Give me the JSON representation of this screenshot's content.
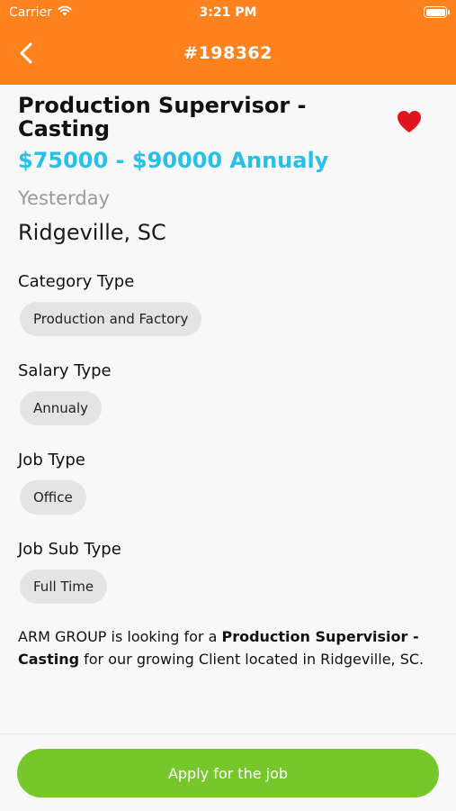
{
  "status_bar": {
    "carrier": "Carrier",
    "time": "3:21 PM"
  },
  "nav": {
    "title": "#198362"
  },
  "job": {
    "title": "Production Supervisor - Casting",
    "salary": "$75000 - $90000 Annualy",
    "posted": "Yesterday",
    "location": "Ridgeville, SC",
    "favorited": true
  },
  "sections": {
    "category": {
      "label": "Category Type",
      "value": "Production and Factory"
    },
    "salary_type": {
      "label": "Salary Type",
      "value": "Annualy"
    },
    "job_type": {
      "label": "Job Type",
      "value": "Office"
    },
    "job_sub_type": {
      "label": "Job Sub Type",
      "value": "Full Time"
    }
  },
  "description": {
    "prefix": "ARM GROUP is looking for a ",
    "highlight": "Production Supervisior - Casting",
    "suffix": " for our growing Client located in Ridgeville, SC."
  },
  "footer": {
    "apply_label": "Apply for the job"
  },
  "colors": {
    "header": "#ff821c",
    "salary": "#27c0e8",
    "apply": "#76c82a",
    "heart": "#e2131c"
  }
}
